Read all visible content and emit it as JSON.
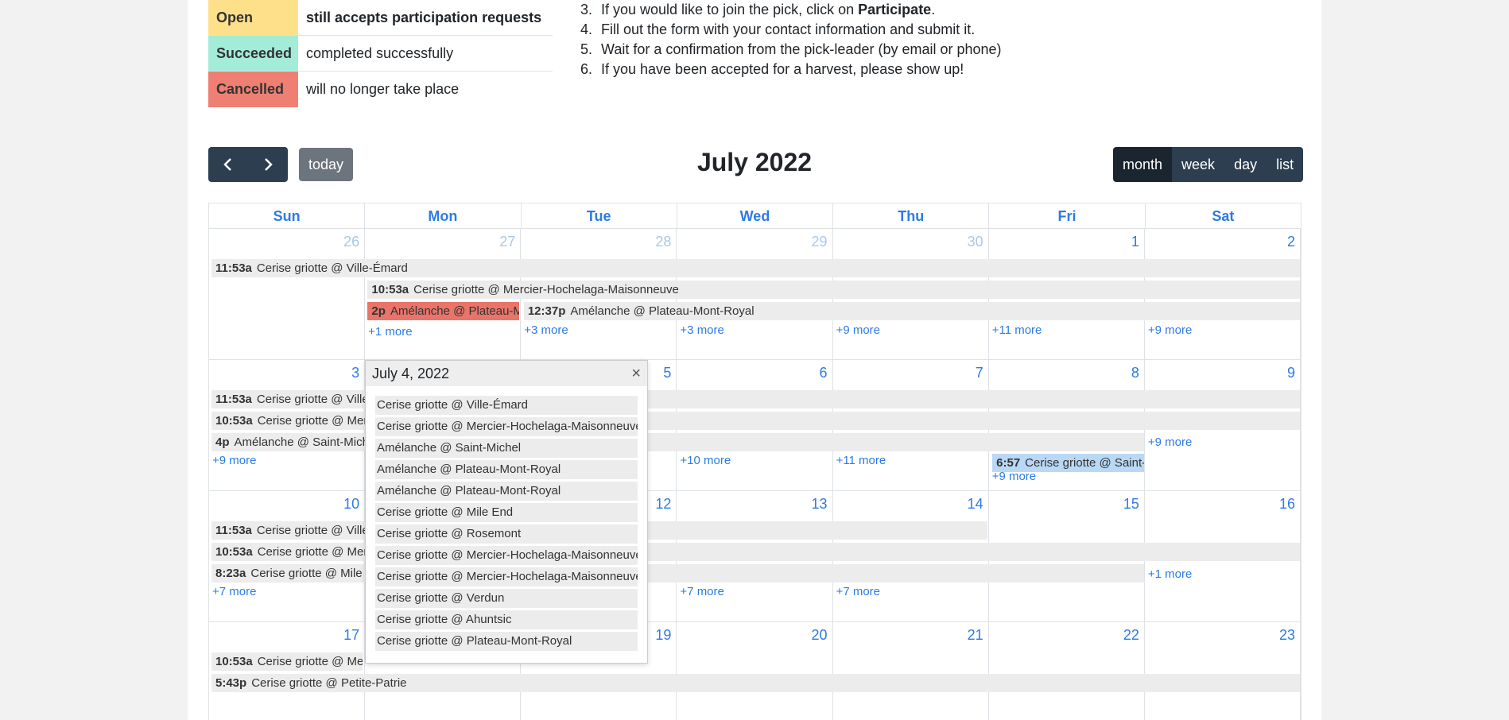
{
  "legend": [
    {
      "label": "Open",
      "desc": "still accepts participation requests",
      "color": "#ffe08a",
      "bold": true
    },
    {
      "label": "Succeeded",
      "desc": "completed successfully",
      "color": "#a3ecd8",
      "bold": false
    },
    {
      "label": "Cancelled",
      "desc": "will no longer take place",
      "color": "#ef7f72",
      "bold": false
    }
  ],
  "steps": [
    {
      "n": "3.",
      "pre": "If you would like to join the pick, click on ",
      "strong": "Participate",
      "post": "."
    },
    {
      "n": "4.",
      "pre": "Fill out the form with your contact information and submit it.",
      "strong": "",
      "post": ""
    },
    {
      "n": "5.",
      "pre": "Wait for a confirmation from the pick-leader (by email or phone)",
      "strong": "",
      "post": ""
    },
    {
      "n": "6.",
      "pre": "If you have been accepted for a harvest, please show up!",
      "strong": "",
      "post": ""
    }
  ],
  "toolbar": {
    "prev": "‹",
    "next": "›",
    "today": "today",
    "title": "July 2022",
    "views": [
      "month",
      "week",
      "day",
      "list"
    ],
    "active_view": "month"
  },
  "days_of_week": [
    "Sun",
    "Mon",
    "Tue",
    "Wed",
    "Thu",
    "Fri",
    "Sat"
  ],
  "weeks": [
    {
      "days": [
        "26",
        "27",
        "28",
        "29",
        "30",
        "1",
        "2"
      ],
      "other": [
        true,
        true,
        true,
        true,
        true,
        false,
        false
      ],
      "more": [
        "",
        "+1 more",
        "+3 more",
        "+3 more",
        "+9 more",
        "+11 more",
        "+9 more"
      ]
    },
    {
      "days": [
        "3",
        "4",
        "5",
        "6",
        "7",
        "8",
        "9"
      ],
      "other": [
        false,
        false,
        false,
        false,
        false,
        false,
        false
      ],
      "more": [
        "+9 more",
        "",
        "",
        "+10 more",
        "+11 more",
        "+9 more",
        "+9 more"
      ]
    },
    {
      "days": [
        "10",
        "11",
        "12",
        "13",
        "14",
        "15",
        "16"
      ],
      "other": [
        false,
        false,
        false,
        false,
        false,
        false,
        false
      ],
      "more": [
        "+7 more",
        "",
        "",
        "+7 more",
        "+7 more",
        "+1 more",
        "+1 more"
      ]
    },
    {
      "days": [
        "17",
        "18",
        "19",
        "20",
        "21",
        "22",
        "23"
      ],
      "other": [
        false,
        false,
        false,
        false,
        false,
        false,
        false
      ],
      "more": [
        "",
        "",
        "",
        "",
        "",
        "",
        ""
      ]
    }
  ],
  "events": {
    "w1": [
      {
        "time": "11:53a",
        "title": "Cerise griotte @ Ville-Émard"
      },
      {
        "time": "10:53a",
        "title": "Cerise griotte @ Mercier-Hochelaga-Maisonneuve"
      },
      {
        "time": "2p",
        "title": "Amélanche @ Plateau-Mont-Royal"
      },
      {
        "time": "12:37p",
        "title": "Amélanche @ Plateau-Mont-Royal"
      }
    ],
    "w2": [
      {
        "time": "11:53a",
        "title": "Cerise griotte @ Ville-Émard"
      },
      {
        "time": "10:53a",
        "title": "Cerise griotte @ Mercier-Hochelaga-Maisonneuve"
      },
      {
        "time": "4p",
        "title": "Amélanche @ Saint-Michel"
      },
      {
        "time": "6:57",
        "title": "Cerise griotte @ Saint-Léonard"
      }
    ],
    "w3": [
      {
        "time": "11:53a",
        "title": "Cerise griotte @ Ville-Émard"
      },
      {
        "time": "10:53a",
        "title": "Cerise griotte @ Mercier-Hochelaga-Maisonneuve"
      },
      {
        "time": "8:23a",
        "title": "Cerise griotte @ Mile End"
      }
    ],
    "w4": [
      {
        "time": "10:53a",
        "title": "Cerise griotte @ Mercier-Hochelaga-Maisonneuve"
      },
      {
        "time": "5:43p",
        "title": "Cerise griotte @ Petite-Patrie"
      }
    ]
  },
  "popover": {
    "title": "July 4, 2022",
    "close": "×",
    "events": [
      "Cerise griotte @ Ville-Émard",
      "Cerise griotte @ Mercier-Hochelaga-Maisonneuve",
      "Amélanche @ Saint-Michel",
      "Amélanche @ Plateau-Mont-Royal",
      "Amélanche @ Plateau-Mont-Royal",
      "Cerise griotte @ Mile End",
      "Cerise griotte @ Rosemont",
      "Cerise griotte @ Mercier-Hochelaga-Maisonneuve",
      "Cerise griotte @ Mercier-Hochelaga-Maisonneuve",
      "Cerise griotte @ Verdun",
      "Cerise griotte @ Ahuntsic",
      "Cerise griotte @ Plateau-Mont-Royal"
    ]
  },
  "colors": {
    "event_bg": "#ececec",
    "cancelled": "#e8746a",
    "selected": "#b9d8f5",
    "link": "#2c7be5",
    "button": "#2c3e50"
  }
}
